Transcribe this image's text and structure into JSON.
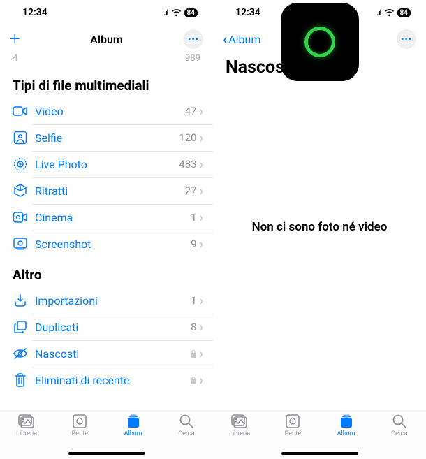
{
  "status": {
    "time": "12:34",
    "battery": "84"
  },
  "left": {
    "title": "Album",
    "faded": {
      "a": "4",
      "b": "989"
    },
    "section_media": "Tipi di file multimediali",
    "media": [
      {
        "label": "Video",
        "count": "47"
      },
      {
        "label": "Selfie",
        "count": "120"
      },
      {
        "label": "Live Photo",
        "count": "483"
      },
      {
        "label": "Ritratti",
        "count": "27"
      },
      {
        "label": "Cinema",
        "count": "1"
      },
      {
        "label": "Screenshot",
        "count": "9"
      }
    ],
    "section_other": "Altro",
    "other": [
      {
        "label": "Importazioni",
        "count": "1",
        "locked": false
      },
      {
        "label": "Duplicati",
        "count": "8",
        "locked": false
      },
      {
        "label": "Nascosti",
        "count": "",
        "locked": true
      },
      {
        "label": "Eliminati di recente",
        "count": "",
        "locked": true
      }
    ]
  },
  "right": {
    "back": "Album",
    "title": "Nascosti",
    "empty": "Non ci sono foto né video"
  },
  "tabs": {
    "library": "Libreria",
    "foryou": "Per te",
    "albums": "Album",
    "search": "Cerca"
  }
}
